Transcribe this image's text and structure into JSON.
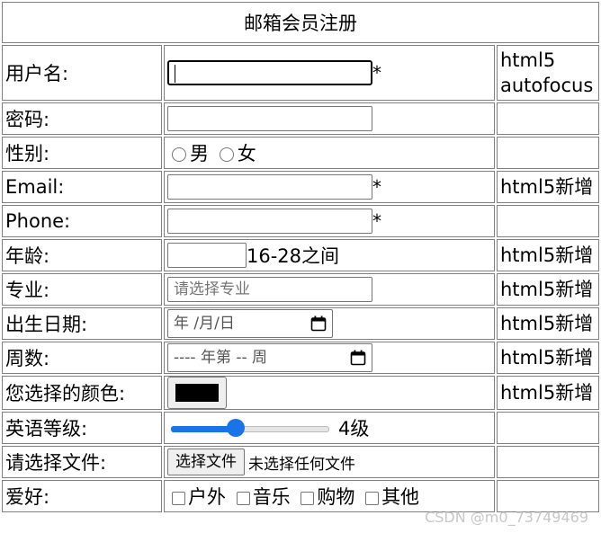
{
  "form": {
    "title": "邮箱会员注册",
    "username": {
      "label": "用户名:",
      "star": "*",
      "note_line1": "html5",
      "note_line2": "autofocus"
    },
    "password": {
      "label": "密码:"
    },
    "gender": {
      "label": "性别:",
      "option_male": "男",
      "option_female": "女"
    },
    "email": {
      "label": "Email:",
      "star": "*",
      "note": "html5新增"
    },
    "phone": {
      "label": "Phone:",
      "star": "*"
    },
    "age": {
      "label": "年龄:",
      "hint": "16-28之间",
      "note": "html5新增"
    },
    "major": {
      "label": "专业:",
      "placeholder": "请选择专业",
      "note": "html5新增"
    },
    "birth": {
      "label": "出生日期:",
      "placeholder": "年 /月/日",
      "note": "html5新增"
    },
    "week": {
      "label": "周数:",
      "placeholder": "---- 年第 -- 周",
      "note": "html5新增"
    },
    "color": {
      "label": "您选择的颜色:",
      "value": "#000000",
      "note": "html5新增"
    },
    "english": {
      "label": "英语等级:",
      "level": 4,
      "max": 10,
      "value_text": "4级"
    },
    "file": {
      "label": "请选择文件:",
      "button": "选择文件",
      "status": "未选择任何文件"
    },
    "hobby": {
      "label": "爱好:",
      "options": [
        "户外",
        "音乐",
        "购物",
        "其他"
      ]
    }
  },
  "watermark": "CSDN @m0_73749469"
}
